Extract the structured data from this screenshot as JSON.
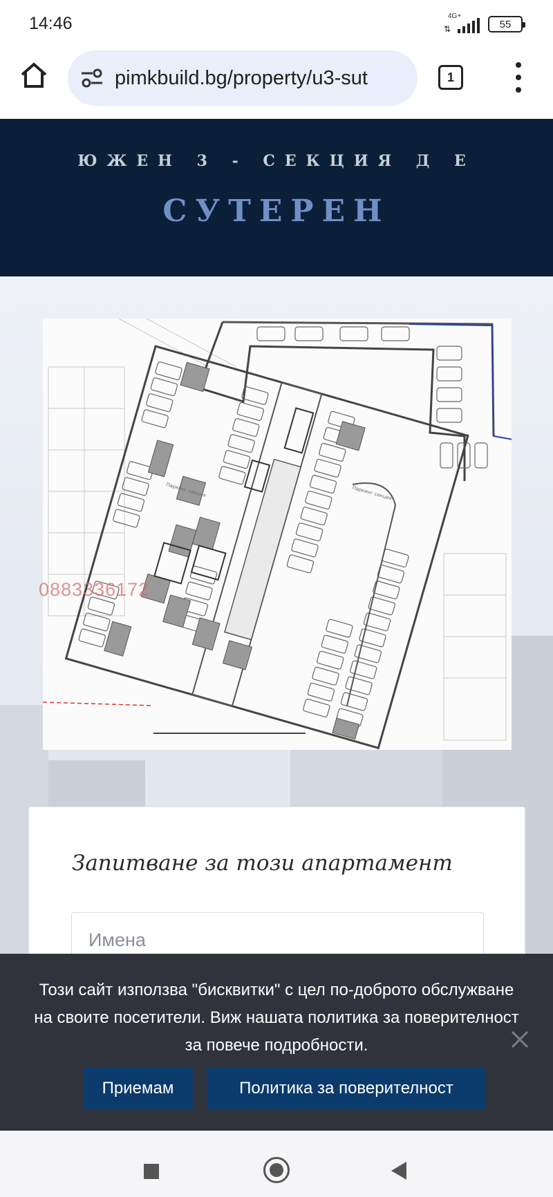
{
  "status_bar": {
    "time": "14:46",
    "network": "4G+",
    "battery": "55"
  },
  "browser": {
    "url": "pimkbuild.bg/property/u3-sut",
    "tab_count": "1",
    "icons": [
      "home-icon",
      "site-settings-icon",
      "tabs-icon",
      "more-vert-icon"
    ]
  },
  "hero": {
    "subtitle": "ЮЖЕН 3 - СЕКЦИЯ Д Е",
    "title": "СУТЕРЕН",
    "background_color": "#0b1f38",
    "title_color": "#6f8fc7"
  },
  "floor_plan": {
    "watermark_phone": "0883336172"
  },
  "inquiry_form": {
    "title": "Запитване за този апартамент",
    "name_placeholder": "Имена"
  },
  "cookie_banner": {
    "text": "Този сайт използва \"бисквитки\" с цел по-доброто обслужване на своите посетители. Виж нашата политика за поверителност за повече подробности.",
    "accept_label": "Приемам",
    "policy_label": "Политика за поверителност",
    "button_color": "#0b3b6c"
  },
  "nav_bar": {
    "icons": [
      "recents-square-icon",
      "home-circle-icon",
      "back-triangle-icon"
    ]
  }
}
